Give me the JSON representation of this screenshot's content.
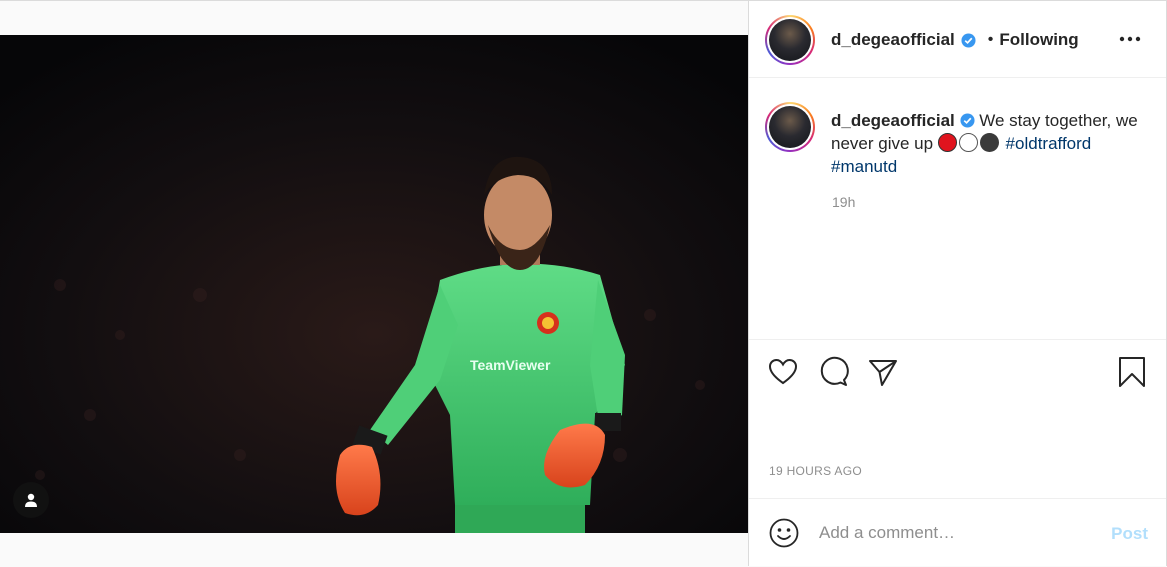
{
  "header": {
    "username": "d_degeaofficial",
    "separator": "•",
    "follow_state": "Following",
    "more_icon": "more-horizontal-icon"
  },
  "caption": {
    "username": "d_degeaofficial",
    "text": "We stay together, we never give up",
    "emojis": [
      "#e0141e",
      "#ffffff",
      "#3a3a3a"
    ],
    "hashtags": [
      "#oldtrafford",
      "#manutd"
    ],
    "time": "19h"
  },
  "post": {
    "sponsor_text": "TeamViewer",
    "time_caps": "19 HOURS AGO"
  },
  "icons": {
    "like": "heart-icon",
    "comment": "comment-bubble-icon",
    "share": "paper-plane-icon",
    "save": "bookmark-icon",
    "emoji": "smiley-icon",
    "tagged": "user-tag-icon",
    "verified": "verified-badge-icon"
  },
  "comment": {
    "placeholder": "Add a comment…",
    "post_label": "Post"
  },
  "colors": {
    "verified": "#3897f0",
    "hashtag": "#00376b",
    "post_disabled": "#b2dffc",
    "jersey": "#3fbf6a"
  }
}
